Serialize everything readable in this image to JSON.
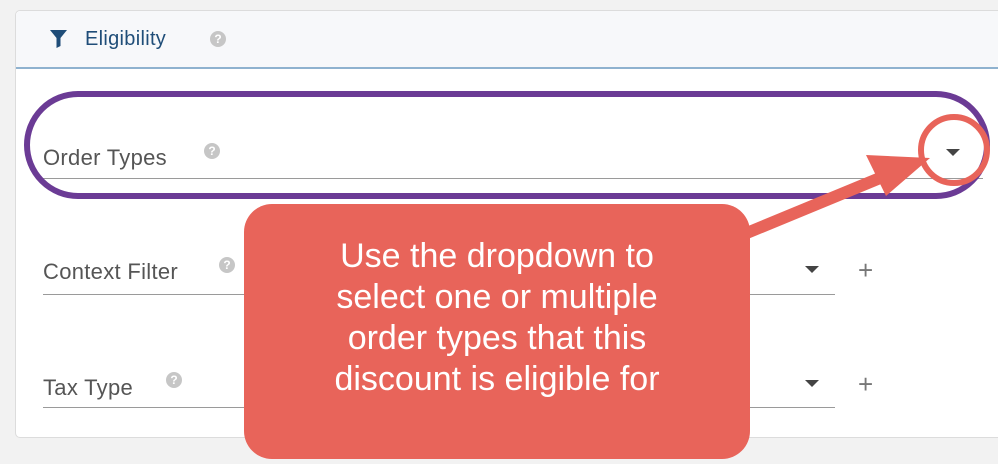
{
  "panel": {
    "title": "Eligibility",
    "help_glyph": "?",
    "icon": "filter-icon"
  },
  "fields": {
    "order_types": {
      "label": "Order Types",
      "help_glyph": "?"
    },
    "context_filter": {
      "label": "Context Filter",
      "help_glyph": "?",
      "add_glyph": "+"
    },
    "tax_type": {
      "label": "Tax Type",
      "help_glyph": "?",
      "add_glyph": "+"
    }
  },
  "annotation": {
    "callout_lines": [
      "Use the dropdown to",
      "select one or multiple",
      "order types that this",
      "discount is eligible for"
    ],
    "colors": {
      "callout": "#e8645a",
      "highlight": "#6b3b95"
    }
  }
}
